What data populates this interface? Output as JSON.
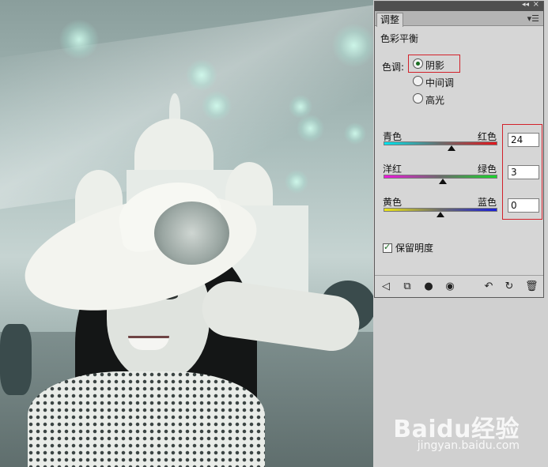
{
  "panel": {
    "tab_label": "调整",
    "adjustment_title": "色彩平衡",
    "tone": {
      "label": "色调:",
      "options": [
        "阴影",
        "中间调",
        "高光"
      ],
      "selected": "阴影"
    },
    "sliders": [
      {
        "left_label": "青色",
        "right_label": "红色",
        "value": "24",
        "position": 0.6,
        "gradient": [
          "#00e4ee",
          "#e3161c"
        ]
      },
      {
        "left_label": "洋红",
        "right_label": "绿色",
        "value": "3",
        "position": 0.52,
        "gradient": [
          "#ef16de",
          "#17d92a"
        ]
      },
      {
        "left_label": "黄色",
        "right_label": "蓝色",
        "value": "0",
        "position": 0.5,
        "gradient": [
          "#ece516",
          "#1b1fd9"
        ]
      }
    ],
    "preserve_luminosity": {
      "label": "保留明度",
      "checked": true
    },
    "highlight_color": "#d2212a"
  },
  "watermark": {
    "brand": "Baidu经验",
    "url": "jingyan.baidu.com"
  },
  "icons": {
    "titlebar": [
      "collapse-icon",
      "close-icon"
    ],
    "menu": "panel-menu-icon",
    "toolbar": [
      "back-arrow-icon",
      "layer-clip-icon",
      "mask-icon",
      "visibility-eye-icon",
      "view-previous-icon",
      "reset-icon",
      "trash-icon"
    ]
  }
}
